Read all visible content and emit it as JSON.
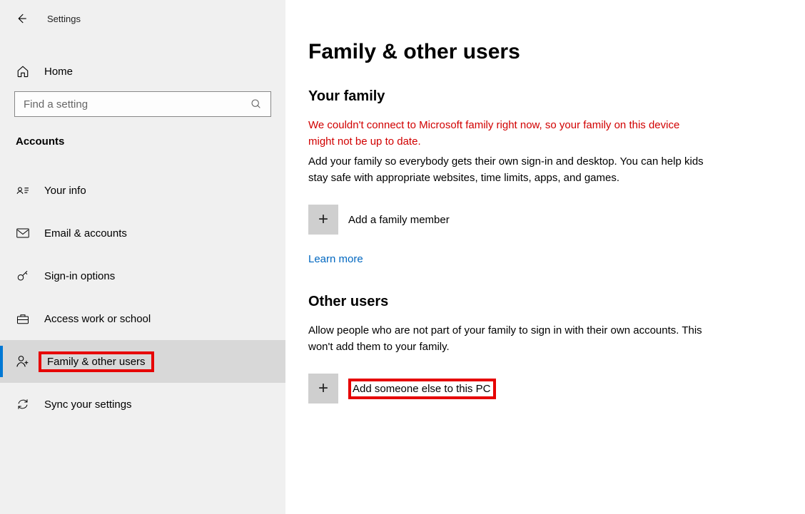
{
  "app_title": "Settings",
  "home_label": "Home",
  "search": {
    "placeholder": "Find a setting"
  },
  "category": "Accounts",
  "nav": [
    {
      "label": "Your info"
    },
    {
      "label": "Email & accounts"
    },
    {
      "label": "Sign-in options"
    },
    {
      "label": "Access work or school"
    },
    {
      "label": "Family & other users"
    },
    {
      "label": "Sync your settings"
    }
  ],
  "page": {
    "title": "Family & other users",
    "family": {
      "heading": "Your family",
      "error": "We couldn't connect to Microsoft family right now, so your family on this device might not be up to date.",
      "desc": "Add your family so everybody gets their own sign-in and desktop. You can help kids stay safe with appropriate websites, time limits, apps, and games.",
      "add_label": "Add a family member",
      "learn_more": "Learn more"
    },
    "other": {
      "heading": "Other users",
      "desc": "Allow people who are not part of your family to sign in with their own accounts. This won't add them to your family.",
      "add_label": "Add someone else to this PC"
    }
  }
}
